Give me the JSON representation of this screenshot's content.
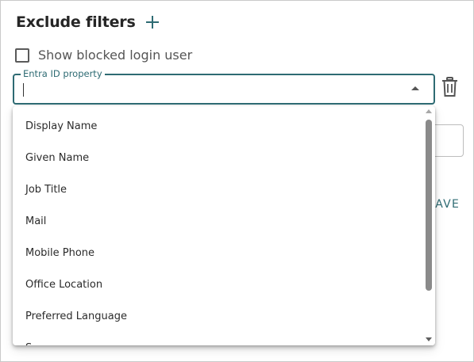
{
  "header": {
    "title": "Exclude filters"
  },
  "options": {
    "show_blocked_label": "Show blocked login user",
    "show_blocked_checked": false
  },
  "property_select": {
    "label": "Entra ID property",
    "value": ""
  },
  "background": {
    "save_label": "AVE"
  },
  "dropdown": {
    "items": [
      {
        "label": "Display Name"
      },
      {
        "label": "Given Name"
      },
      {
        "label": "Job Title"
      },
      {
        "label": "Mail"
      },
      {
        "label": "Mobile Phone"
      },
      {
        "label": "Office Location"
      },
      {
        "label": "Preferred Language"
      },
      {
        "label": "S"
      }
    ]
  },
  "colors": {
    "accent": "#2e6b73",
    "text": "#262626",
    "muted": "#555555"
  }
}
